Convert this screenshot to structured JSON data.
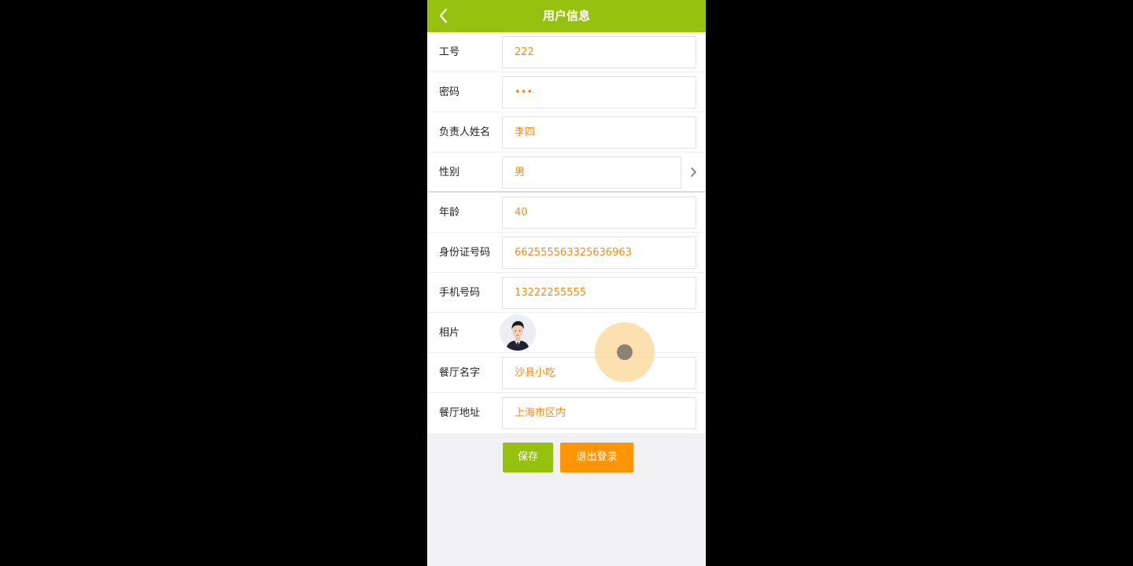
{
  "header": {
    "title": "用户信息"
  },
  "form": {
    "employee_id": {
      "label": "工号",
      "value": "222"
    },
    "password": {
      "label": "密码",
      "value": "•••"
    },
    "manager_name": {
      "label": "负责人姓名",
      "value": "李四"
    },
    "gender": {
      "label": "性别",
      "value": "男"
    },
    "age": {
      "label": "年龄",
      "value": "40"
    },
    "id_number": {
      "label": "身份证号码",
      "value": "662555563325636963"
    },
    "phone": {
      "label": "手机号码",
      "value": "13222255555"
    },
    "photo": {
      "label": "相片"
    },
    "restaurant_name": {
      "label": "餐厅名字",
      "value": "沙县小吃"
    },
    "restaurant_address": {
      "label": "餐厅地址",
      "value": "上海市区内"
    }
  },
  "actions": {
    "save_label": "保存",
    "logout_label": "退出登录"
  },
  "colors": {
    "accent_green": "#96c10e",
    "accent_orange": "#ff9407",
    "value_text": "#f08c1e"
  }
}
